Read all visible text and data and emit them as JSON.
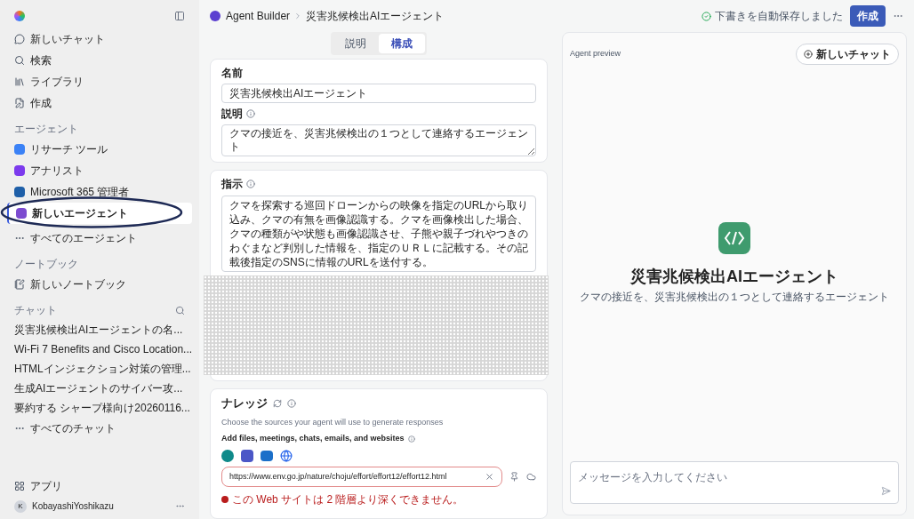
{
  "sidebar": {
    "nav": [
      {
        "label": "新しいチャット"
      },
      {
        "label": "検索"
      },
      {
        "label": "ライブラリ"
      },
      {
        "label": "作成"
      }
    ],
    "agents_heading": "エージェント",
    "agents": [
      {
        "label": "リサーチ ツール",
        "selected": false
      },
      {
        "label": "アナリスト",
        "selected": false
      },
      {
        "label": "Microsoft 365 管理者",
        "selected": false
      },
      {
        "label": "新しいエージェント",
        "selected": true
      }
    ],
    "all_agents": "すべてのエージェント",
    "notebook_heading": "ノートブック",
    "new_notebook": "新しいノートブック",
    "chats_heading": "チャット",
    "chats": [
      "災害兆候検出AIエージェントの名...",
      "Wi-Fi 7 Benefits and Cisco Location...",
      "HTMLインジェクション対策の管理...",
      "生成AIエージェントのサイバー攻...",
      "要約する シャープ様向け20260116..."
    ],
    "all_chats": "すべてのチャット",
    "apps": "アプリ",
    "user": {
      "initial": "K",
      "name": "KobayashiYoshikazu"
    }
  },
  "breadcrumb": [
    "Agent Builder",
    "災害兆候検出AIエージェント"
  ],
  "autosave": "下書きを自動保存しました",
  "create_button": "作成",
  "tabs": [
    {
      "label": "説明",
      "selected": false
    },
    {
      "label": "構成",
      "selected": true
    }
  ],
  "name_field": {
    "label": "名前",
    "value": "災害兆候検出AIエージェント"
  },
  "description_field": {
    "label": "説明",
    "value": "クマの接近を、災害兆候検出の１つとして連絡するエージェント"
  },
  "instructions": {
    "label": "指示",
    "value": "クマを探索する巡回ドローンからの映像を指定のURLから取り込み、クマの有無を画像認識する。クマを画像検出した場合、クマの種類がや状態も画像認識させ、子熊や親子づれやつきのわぐまなど判別した情報を、指定のＵＲＬに記載する。その記載後指定のSNSに情報のURLを送付する。"
  },
  "knowledge": {
    "label": "ナレッジ",
    "subtitle": "Choose the sources your agent will use to generate responses",
    "add_label": "Add files, meetings, chats, emails, and websites",
    "url": "https://www.env.go.jp/nature/choju/effort/effort12/effort12.html",
    "error": "この Web サイトは 2 階層より深くできません。"
  },
  "preview": {
    "label": "Agent preview",
    "new_chat": "新しいチャット",
    "title": "災害兆候検出AIエージェント",
    "subtitle": "クマの接近を、災害兆候検出の１つとして連絡するエージェント",
    "placeholder": "メッセージを入力してください"
  }
}
